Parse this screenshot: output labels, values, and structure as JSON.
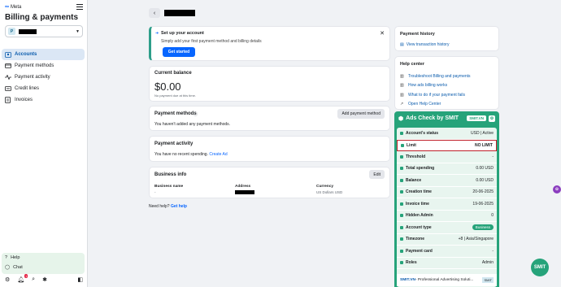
{
  "sidebar": {
    "brand": "Meta",
    "title": "Billing & payments",
    "account_initial": "P",
    "nav": [
      {
        "label": "Accounts",
        "icon": "account-icon"
      },
      {
        "label": "Payment methods",
        "icon": "card-icon"
      },
      {
        "label": "Payment activity",
        "icon": "activity-icon"
      },
      {
        "label": "Credit lines",
        "icon": "credit-icon"
      },
      {
        "label": "Invoices",
        "icon": "invoice-icon"
      }
    ],
    "help": "Help",
    "chat": "Chat",
    "notification_count": "1"
  },
  "setup": {
    "title": "Set up your account",
    "desc": "Simply add your first payment method and billing details",
    "button": "Get started"
  },
  "balance": {
    "title": "Current balance",
    "amount": "$0.00",
    "note": "No payment due at this time."
  },
  "payment_methods": {
    "title": "Payment methods",
    "desc": "You haven't added any payment methods.",
    "button": "Add payment method"
  },
  "payment_activity": {
    "title": "Payment activity",
    "desc": "You have no recent spending.",
    "link": "Create Ad"
  },
  "business_info": {
    "title": "Business info",
    "edit": "Edit",
    "name_label": "Business name",
    "name_value": "-",
    "address_label": "Address",
    "currency_label": "Currency",
    "currency_value": "US Dollars USD"
  },
  "help_line": {
    "text": "Need help?",
    "link": "Get help"
  },
  "payment_history": {
    "title": "Payment history",
    "link": "View transaction history"
  },
  "help_center": {
    "title": "Help center",
    "items": [
      "Troubleshoot Billing and payments",
      "How ads billing works",
      "What to do if your payment fails",
      "Open Help Center"
    ]
  },
  "smit": {
    "title": "Ads Check by SMIT",
    "tag": "SMIT.VN",
    "rows": [
      {
        "k": "Account's status",
        "v": "USD | Active"
      },
      {
        "k": "Limit",
        "v": "NO LIMIT"
      },
      {
        "k": "Threshold",
        "v": "-"
      },
      {
        "k": "Total spending",
        "v": "0.00 USD"
      },
      {
        "k": "Balance",
        "v": "0.00 USD"
      },
      {
        "k": "Creation time",
        "v": "20-06-2025"
      },
      {
        "k": "Invoice time",
        "v": "19-06-2025"
      },
      {
        "k": "Hidden Admin",
        "v": "0"
      },
      {
        "k": "Account type",
        "v": "Business"
      },
      {
        "k": "Timezone",
        "v": "+8 | Asia/Singapore"
      },
      {
        "k": "Payment card",
        "v": "-"
      },
      {
        "k": "Roles",
        "v": "Admin"
      }
    ],
    "footer_brand": "SMIT.VN",
    "footer_text": " - Professional Advertising Soluti...",
    "footer_flag": "SMIT",
    "float_label": "SMIT"
  }
}
